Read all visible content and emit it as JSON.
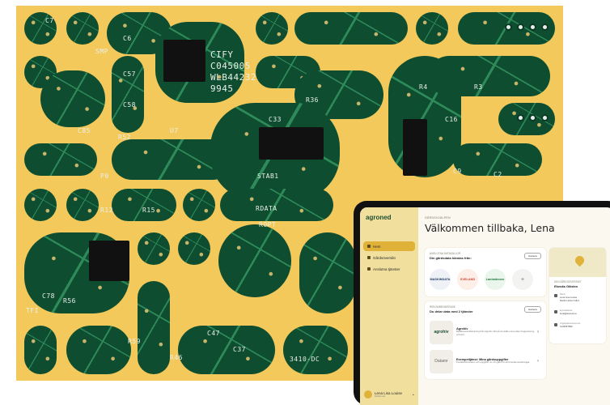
{
  "board": {
    "silk_labels": [
      "C7",
      "SMP",
      "C6",
      "C57",
      "C58",
      "C85",
      "R52",
      "CIFY",
      "C045005",
      "WLB44232",
      "9945",
      "R36",
      "C33",
      "R4",
      "R3",
      "C16",
      "C9",
      "C2",
      "STAB1",
      "RDATA",
      "R15",
      "R12",
      "C78",
      "TFI",
      "R56",
      "C47",
      "R46",
      "R59",
      "C37",
      "3410-DC",
      "P0",
      "U7",
      "ROPT"
    ]
  },
  "app": {
    "logo": "agroned",
    "nav": [
      {
        "label": "Hem",
        "icon": "home-icon",
        "active": true
      },
      {
        "label": "Gårdsöversikt",
        "icon": "farm-icon",
        "active": false
      },
      {
        "label": "Anslutna tjänster",
        "icon": "location-pin-icon",
        "active": false
      }
    ],
    "user": {
      "name": "Lena Lisa Louise",
      "sub": "Mjölkbonde",
      "icon": "chevron-down-icon"
    },
    "kicker": "GÅRDSHJÄLPEN",
    "welcome": "Välkommen tillbaka, Lena",
    "sources_card": {
      "label": "ANSLUTNA DATAKÄLLOR",
      "title": "Din gårdsdata hämtas från:",
      "button": "Hantera",
      "brands": [
        {
          "name": "MASKINDATA",
          "color": "#1f3b63"
        },
        {
          "name": "SVELAND",
          "color": "#d0452b"
        },
        {
          "name": "Lantmännen",
          "color": "#1f7a3a"
        },
        {
          "name": "+",
          "color": "#9a9a9a"
        }
      ]
    },
    "services_card": {
      "label": "REKOMMENDERADE",
      "title": "Du delar data med 2 tjänster",
      "button": "Hantera",
      "services": [
        {
          "logo": "agrohiv",
          "name": "Agrohiv",
          "desc": "Mjölkleveranshantering från Agrohiv. Allt på ett ställe med enkel inrapportering och koll."
        },
        {
          "logo": "Datamr",
          "name": "Exempeltjänst: Mina gårdsuppgifter",
          "desc": "Kontaktinformation och uppgifter om din gård för att förenkla ansökningar."
        }
      ],
      "chevron_icon": "chevron-right-icon"
    },
    "farm_card": {
      "map_icon": "map-pin-icon",
      "label": "DIN GÅRDSÖVERSIKT",
      "name": "Ekenäs Gården",
      "rows": [
        {
          "icon": "home-icon",
          "label": "Namn",
          "value": "Lena Lisa Louise",
          "value2": "Martin Holzer Gård"
        },
        {
          "icon": "mail-icon",
          "label": "E-postadress",
          "value": "lena@ekenas.se"
        },
        {
          "icon": "id-icon",
          "label": "Organisationsnummer",
          "value": "1234567890"
        }
      ]
    }
  }
}
